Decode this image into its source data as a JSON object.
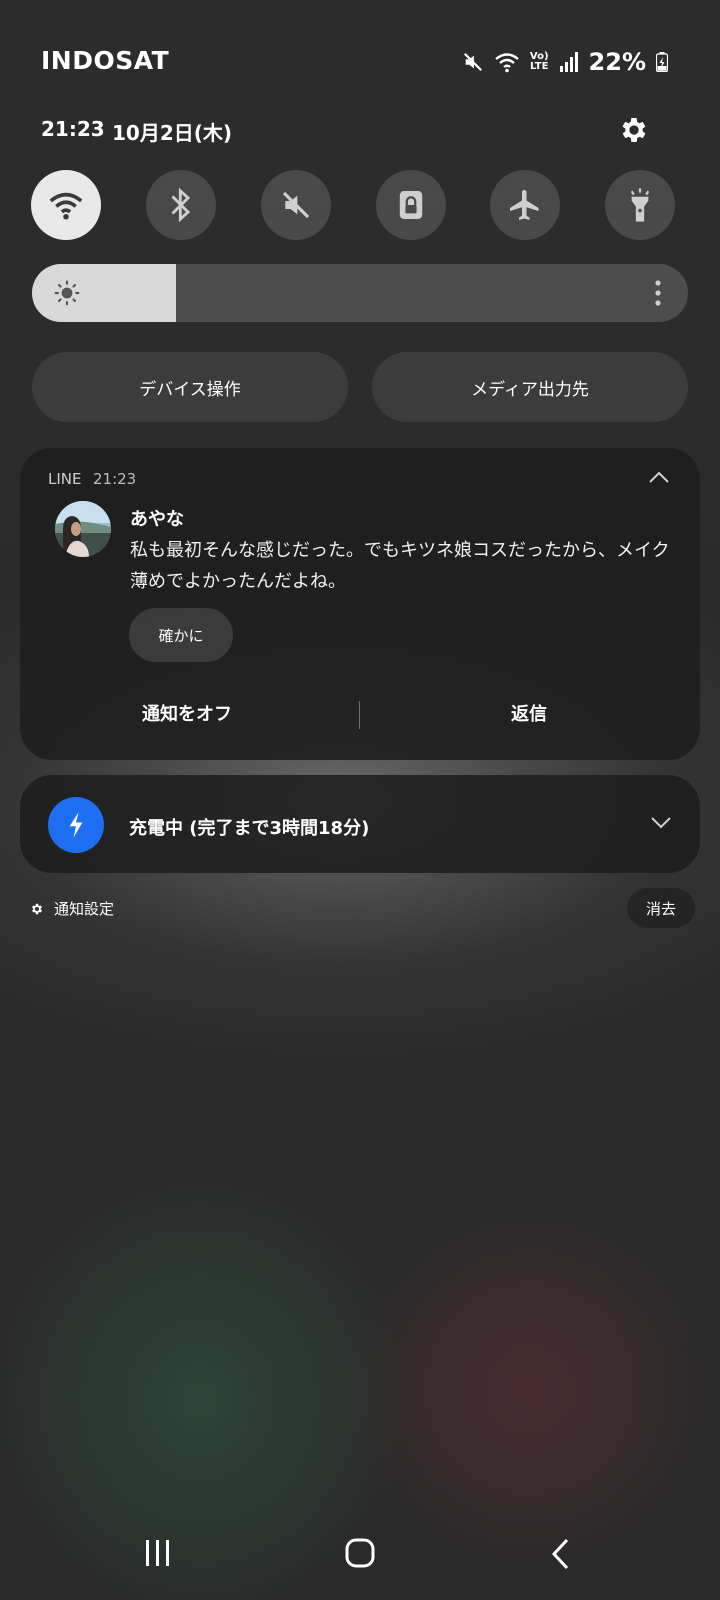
{
  "status_bar": {
    "carrier": "INDOSAT",
    "volte_top": "Vo)",
    "volte_bottom": "LTE",
    "battery_percent": "22%",
    "icons": [
      "mute-icon",
      "wifi-icon",
      "volte-icon",
      "signal-icon",
      "battery-charging-icon"
    ]
  },
  "header": {
    "time": "21:23",
    "date": "10月2日(木)"
  },
  "quick_settings": {
    "tiles": [
      {
        "name": "wifi",
        "icon": "wifi-icon",
        "state": "on"
      },
      {
        "name": "bluetooth",
        "icon": "bluetooth-icon",
        "state": "off"
      },
      {
        "name": "sound",
        "icon": "mute-icon",
        "state": "off"
      },
      {
        "name": "rotation-lock",
        "icon": "lock-icon",
        "state": "off"
      },
      {
        "name": "airplane",
        "icon": "airplane-icon",
        "state": "off"
      },
      {
        "name": "flashlight",
        "icon": "flashlight-icon",
        "state": "off"
      }
    ],
    "brightness_level": 0.22,
    "device_control_label": "デバイス操作",
    "media_output_label": "メディア出力先"
  },
  "notification": {
    "app": "LINE",
    "time": "21:23",
    "sender": "あやな",
    "message": "私も最初そんな感じだった。でもキツネ娘コスだったから、メイク薄めでよかったんだよね。",
    "quick_reply": "確かに",
    "action_off": "通知をオフ",
    "action_reply": "返信"
  },
  "charging": {
    "text": "充電中 (完了まで3時間18分)",
    "accent": "#1e6ef2"
  },
  "footer": {
    "notification_settings": "通知設定",
    "clear": "消去"
  }
}
